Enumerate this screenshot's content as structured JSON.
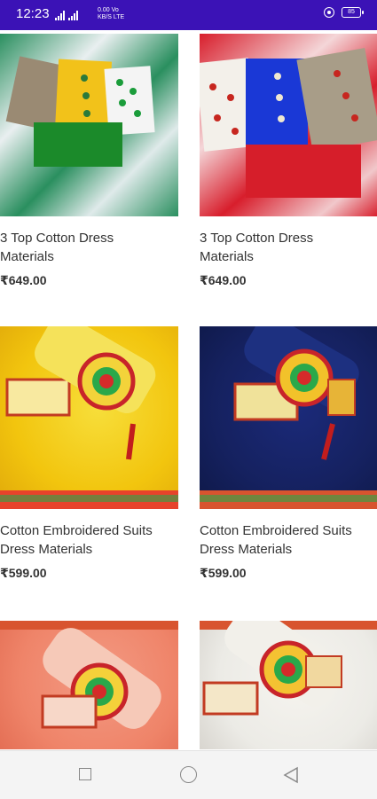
{
  "status_bar": {
    "time": "12:23",
    "net_speed_top": "0.00",
    "net_speed_unit": "KB/S",
    "net_type_top": "Vo",
    "net_type_bottom": "LTE",
    "battery": "85"
  },
  "products": [
    {
      "title": "3 Top Cotton Dress\nMaterials",
      "price": "₹649.00"
    },
    {
      "title": "3 Top Cotton Dress\nMaterials",
      "price": "₹649.00"
    },
    {
      "title": "Cotton Embroidered Suits\nDress Materials",
      "price": "₹599.00"
    },
    {
      "title": "Cotton Embroidered Suits\nDress Materials",
      "price": "₹599.00"
    },
    {
      "title": "",
      "price": ""
    },
    {
      "title": "",
      "price": ""
    }
  ],
  "nav": {
    "icons": [
      "recent-apps-icon",
      "home-icon",
      "back-icon"
    ]
  },
  "colors": {
    "status_bar": "#3b12b6",
    "text": "#333333"
  }
}
